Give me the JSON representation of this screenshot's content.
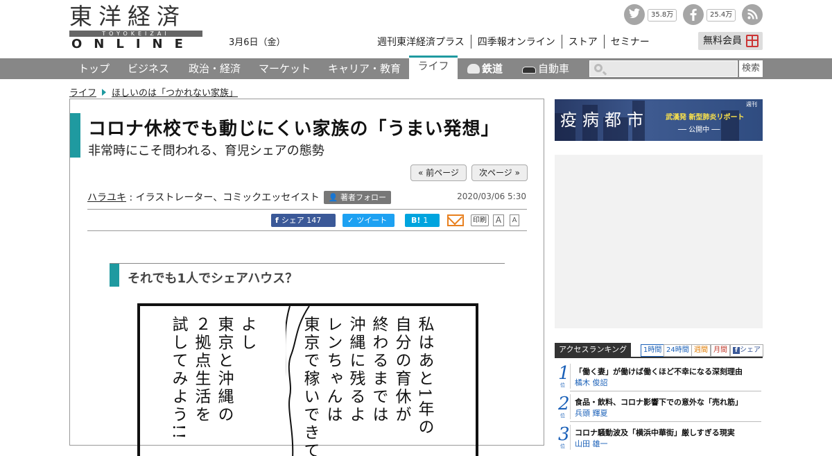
{
  "header": {
    "logo_kanji": "東洋経済",
    "logo_romaji": "TOYOKEIZAI",
    "logo_online": "ONLINE",
    "date": "3月6日（金）",
    "twitter_count": "35.8万",
    "facebook_count": "25.4万",
    "top_links": [
      "週刊東洋経済プラス",
      "四季報オンライン",
      "ストア",
      "セミナー"
    ],
    "free_member": "無料会員"
  },
  "nav": {
    "items": [
      "トップ",
      "ビジネス",
      "政治・経済",
      "マーケット",
      "キャリア・教育",
      "ライフ",
      "鉄道",
      "自動車"
    ],
    "active_index": 5,
    "search_button": "検索",
    "search_placeholder": ""
  },
  "breadcrumb": {
    "section": "ライフ",
    "series": "ほしいのは「つかれない家族」"
  },
  "article": {
    "title": "コロナ休校でも動じにくい家族の「うまい発想」",
    "subtitle": "非常時にこそ問われる、育児シェアの態勢",
    "prev_page": "« 前ページ",
    "next_page": "次ページ »",
    "author_name": "ハラユキ",
    "author_role": " : イラストレーター、コミックエッセイスト",
    "follow_label": "著者フォロー",
    "published": "2020/03/06 5:30",
    "share_fb": "シェア 147",
    "share_tw": "ツイート",
    "share_hatena": "1",
    "hatena_icon_text": "B!",
    "print": "印刷",
    "font_large": "A",
    "font_small": "A",
    "section_heading": "それでも1人でシェアハウス？",
    "comic_right": [
      "私はあと1年の",
      "自分の育休が",
      "終わるまでは",
      "沖縄に残るよ",
      "レンちゃんは",
      "東京で稼いできて"
    ],
    "comic_left": [
      "よし",
      "東京と沖縄の",
      "２拠点生活を",
      "試してみよう!!"
    ]
  },
  "sidebar": {
    "banner_title": "疫病都市",
    "banner_sub": "武漢発 新型肺炎リポート",
    "banner_live": "── 公開中 ──",
    "banner_corner": "週刊",
    "ranking_label": "アクセスランキング",
    "ranking_tabs": [
      "1時間",
      "24時間",
      "週間",
      "月間",
      "シェア"
    ],
    "ranking": [
      {
        "rank": "1",
        "unit": "位",
        "title": "「働く妻」が働けば働くほど不幸になる深刻理由",
        "author": "橘木 俊詔"
      },
      {
        "rank": "2",
        "unit": "位",
        "title": "食品・飲料、コロナ影響下での意外な「売れ筋」",
        "author": "兵頭 輝夏"
      },
      {
        "rank": "3",
        "unit": "位",
        "title": "コロナ騒動波及「横浜中華街」厳しすぎる現実",
        "author": "山田 雄一"
      }
    ]
  },
  "colors": {
    "accent": "#1f9aa0",
    "nav_bg": "#878787",
    "rank_blue": "#1a60b8",
    "facebook": "#3b5998",
    "twitter": "#1da1f2",
    "hatena": "#00a4de",
    "mail": "#e8801f"
  },
  "icons": [
    "twitter-icon",
    "facebook-icon",
    "rss-icon",
    "gift-icon",
    "train-icon",
    "car-icon",
    "search-icon",
    "mail-icon"
  ]
}
